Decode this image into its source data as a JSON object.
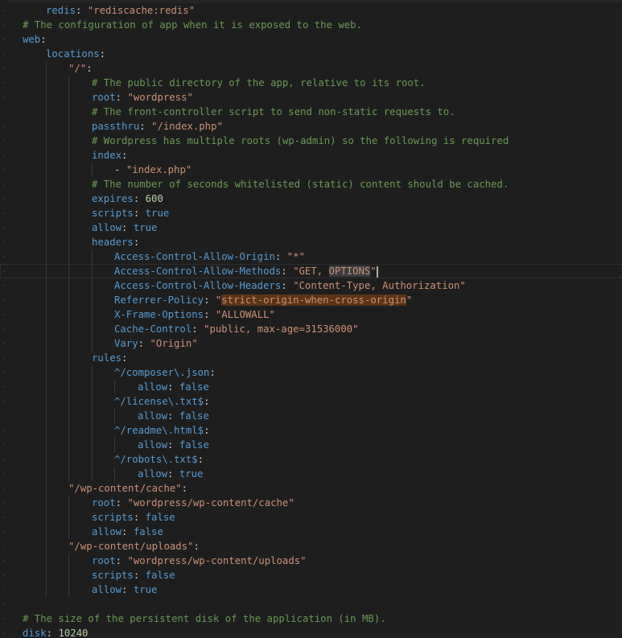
{
  "editor": {
    "lines": [
      [
        {
          "t": "redis",
          "c": "k"
        },
        {
          "t": ": ",
          "c": "p"
        },
        {
          "t": "\"rediscache:redis\"",
          "c": "s"
        }
      ],
      [
        {
          "t": "# The configuration of app when it is exposed to the web.",
          "c": "c"
        }
      ],
      [
        {
          "t": "web",
          "c": "k"
        },
        {
          "t": ":",
          "c": "p"
        }
      ],
      [
        {
          "t": "locations",
          "c": "k"
        },
        {
          "t": ":",
          "c": "p"
        }
      ],
      [
        {
          "t": "\"/\"",
          "c": "s"
        },
        {
          "t": ":",
          "c": "p"
        }
      ],
      [
        {
          "t": "# The public directory of the app, relative to its root.",
          "c": "c"
        }
      ],
      [
        {
          "t": "root",
          "c": "k"
        },
        {
          "t": ": ",
          "c": "p"
        },
        {
          "t": "\"wordpress\"",
          "c": "s"
        }
      ],
      [
        {
          "t": "# The front-controller script to send non-static requests to.",
          "c": "c"
        }
      ],
      [
        {
          "t": "passthru",
          "c": "k"
        },
        {
          "t": ": ",
          "c": "p"
        },
        {
          "t": "\"/index.php\"",
          "c": "s"
        }
      ],
      [
        {
          "t": "# Wordpress has multiple roots (wp-admin) so the following is required",
          "c": "c"
        }
      ],
      [
        {
          "t": "index",
          "c": "k"
        },
        {
          "t": ":",
          "c": "p"
        }
      ],
      [
        {
          "t": "- ",
          "c": "p"
        },
        {
          "t": "\"index.php\"",
          "c": "s"
        }
      ],
      [
        {
          "t": "# The number of seconds whitelisted (static) content should be cached.",
          "c": "c"
        }
      ],
      [
        {
          "t": "expires",
          "c": "k"
        },
        {
          "t": ": ",
          "c": "p"
        },
        {
          "t": "600",
          "c": "n"
        }
      ],
      [
        {
          "t": "scripts",
          "c": "k"
        },
        {
          "t": ": ",
          "c": "p"
        },
        {
          "t": "true",
          "c": "k"
        }
      ],
      [
        {
          "t": "allow",
          "c": "k"
        },
        {
          "t": ": ",
          "c": "p"
        },
        {
          "t": "true",
          "c": "k"
        }
      ],
      [
        {
          "t": "headers",
          "c": "k"
        },
        {
          "t": ":",
          "c": "p"
        }
      ],
      [
        {
          "t": "Access-Control-Allow-Origin",
          "c": "k"
        },
        {
          "t": ": ",
          "c": "p"
        },
        {
          "t": "\"*\"",
          "c": "s"
        }
      ],
      [
        {
          "t": "Access-Control-Allow-Methods",
          "c": "k"
        },
        {
          "t": ": ",
          "c": "p"
        },
        {
          "t": "\"GET, ",
          "c": "s"
        },
        {
          "t": "OPTIONS",
          "c": "s sel"
        },
        {
          "t": "\"",
          "c": "s"
        }
      ],
      [
        {
          "t": "Access-Control-Allow-Headers",
          "c": "k"
        },
        {
          "t": ": ",
          "c": "p"
        },
        {
          "t": "\"Content-Type, Authorization\"",
          "c": "s"
        }
      ],
      [
        {
          "t": "Referrer-Policy",
          "c": "k"
        },
        {
          "t": ": ",
          "c": "p"
        },
        {
          "t": "\"",
          "c": "s"
        },
        {
          "t": "strict-origin-when-cross-origin",
          "c": "s hl"
        },
        {
          "t": "\"",
          "c": "s"
        }
      ],
      [
        {
          "t": "X-Frame-Options",
          "c": "k"
        },
        {
          "t": ": ",
          "c": "p"
        },
        {
          "t": "\"ALLOWALL\"",
          "c": "s"
        }
      ],
      [
        {
          "t": "Cache-Control",
          "c": "k"
        },
        {
          "t": ": ",
          "c": "p"
        },
        {
          "t": "\"public, max-age=31536000\"",
          "c": "s"
        }
      ],
      [
        {
          "t": "Vary",
          "c": "k"
        },
        {
          "t": ": ",
          "c": "p"
        },
        {
          "t": "\"Origin\"",
          "c": "s"
        }
      ],
      [
        {
          "t": "rules",
          "c": "k"
        },
        {
          "t": ":",
          "c": "p"
        }
      ],
      [
        {
          "t": "^/composer\\.json",
          "c": "k"
        },
        {
          "t": ":",
          "c": "p"
        }
      ],
      [
        {
          "t": "allow",
          "c": "k"
        },
        {
          "t": ": ",
          "c": "p"
        },
        {
          "t": "false",
          "c": "k"
        }
      ],
      [
        {
          "t": "^/license\\.txt$",
          "c": "k"
        },
        {
          "t": ":",
          "c": "p"
        }
      ],
      [
        {
          "t": "allow",
          "c": "k"
        },
        {
          "t": ": ",
          "c": "p"
        },
        {
          "t": "false",
          "c": "k"
        }
      ],
      [
        {
          "t": "^/readme\\.html$",
          "c": "k"
        },
        {
          "t": ":",
          "c": "p"
        }
      ],
      [
        {
          "t": "allow",
          "c": "k"
        },
        {
          "t": ": ",
          "c": "p"
        },
        {
          "t": "false",
          "c": "k"
        }
      ],
      [
        {
          "t": "^/robots\\.txt$",
          "c": "k"
        },
        {
          "t": ":",
          "c": "p"
        }
      ],
      [
        {
          "t": "allow",
          "c": "k"
        },
        {
          "t": ": ",
          "c": "p"
        },
        {
          "t": "true",
          "c": "k"
        }
      ],
      [
        {
          "t": "\"/wp-content/cache\"",
          "c": "s"
        },
        {
          "t": ":",
          "c": "p"
        }
      ],
      [
        {
          "t": "root",
          "c": "k"
        },
        {
          "t": ": ",
          "c": "p"
        },
        {
          "t": "\"wordpress/wp-content/cache\"",
          "c": "s"
        }
      ],
      [
        {
          "t": "scripts",
          "c": "k"
        },
        {
          "t": ": ",
          "c": "p"
        },
        {
          "t": "false",
          "c": "k"
        }
      ],
      [
        {
          "t": "allow",
          "c": "k"
        },
        {
          "t": ": ",
          "c": "p"
        },
        {
          "t": "false",
          "c": "k"
        }
      ],
      [
        {
          "t": "\"/wp-content/uploads\"",
          "c": "s"
        },
        {
          "t": ":",
          "c": "p"
        }
      ],
      [
        {
          "t": "root",
          "c": "k"
        },
        {
          "t": ": ",
          "c": "p"
        },
        {
          "t": "\"wordpress/wp-content/uploads\"",
          "c": "s"
        }
      ],
      [
        {
          "t": "scripts",
          "c": "k"
        },
        {
          "t": ": ",
          "c": "p"
        },
        {
          "t": "false",
          "c": "k"
        }
      ],
      [
        {
          "t": "allow",
          "c": "k"
        },
        {
          "t": ": ",
          "c": "p"
        },
        {
          "t": "true",
          "c": "k"
        }
      ],
      [],
      [
        {
          "t": "# The size of the persistent disk of the application (in MB).",
          "c": "c"
        }
      ],
      [
        {
          "t": "disk",
          "c": "k"
        },
        {
          "t": ": ",
          "c": "p"
        },
        {
          "t": "10240",
          "c": "n"
        }
      ]
    ]
  },
  "colors": {
    "background": "#1e1e1e",
    "key": "#569cd6",
    "string": "#ce9178",
    "comment": "#6a9955",
    "number": "#b5cea8",
    "find_highlight": "#5a3417",
    "selection": "#3a3d41"
  }
}
